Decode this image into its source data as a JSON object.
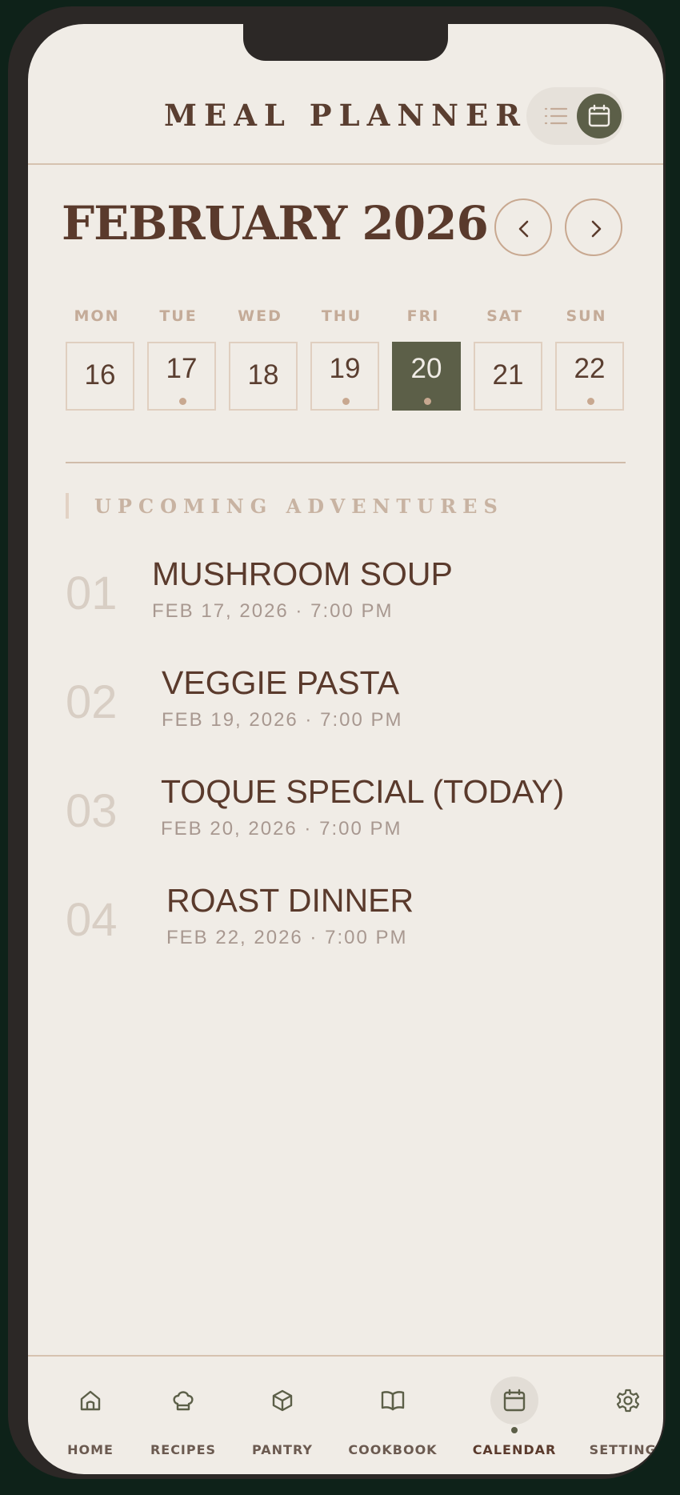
{
  "app": {
    "title": "MEAL PLANNER",
    "view_toggle": {
      "options": [
        "list-icon",
        "calendar-icon"
      ],
      "active": "calendar-icon"
    }
  },
  "calendar": {
    "month_title": "FEBRUARY 2026",
    "prev_icon": "chevron-left-icon",
    "next_icon": "chevron-right-icon",
    "days": [
      {
        "label": "MON",
        "date": "16",
        "has_event": false,
        "active": false
      },
      {
        "label": "TUE",
        "date": "17",
        "has_event": true,
        "active": false
      },
      {
        "label": "WED",
        "date": "18",
        "has_event": false,
        "active": false
      },
      {
        "label": "THU",
        "date": "19",
        "has_event": true,
        "active": false
      },
      {
        "label": "FRI",
        "date": "20",
        "has_event": true,
        "active": true
      },
      {
        "label": "SAT",
        "date": "21",
        "has_event": false,
        "active": false
      },
      {
        "label": "SUN",
        "date": "22",
        "has_event": true,
        "active": false
      }
    ]
  },
  "upcoming": {
    "section_title": "UPCOMING ADVENTURES",
    "events": [
      {
        "index": "01",
        "name": "MUSHROOM SOUP",
        "meta": "FEB 17, 2026 · 7:00 PM"
      },
      {
        "index": "02",
        "name": "VEGGIE PASTA",
        "meta": "FEB 19, 2026 · 7:00 PM"
      },
      {
        "index": "03",
        "name": "TOQUE SPECIAL (TODAY)",
        "meta": "FEB 20, 2026 · 7:00 PM"
      },
      {
        "index": "04",
        "name": "ROAST DINNER",
        "meta": "FEB 22, 2026 · 7:00 PM"
      }
    ]
  },
  "bottom_nav": {
    "items": [
      {
        "label": "HOME",
        "icon": "home-icon",
        "active": false
      },
      {
        "label": "RECIPES",
        "icon": "chef-hat-icon",
        "active": false
      },
      {
        "label": "PANTRY",
        "icon": "box-icon",
        "active": false
      },
      {
        "label": "COOKBOOK",
        "icon": "book-icon",
        "active": false
      },
      {
        "label": "CALENDAR",
        "icon": "calendar-icon",
        "active": true
      },
      {
        "label": "SETTINGS",
        "icon": "gear-icon",
        "active": false
      }
    ]
  },
  "colors": {
    "background": "#f0ece6",
    "accent": "#5c5f48",
    "text_primary": "#5a3a2c",
    "muted": "#c8a890"
  }
}
